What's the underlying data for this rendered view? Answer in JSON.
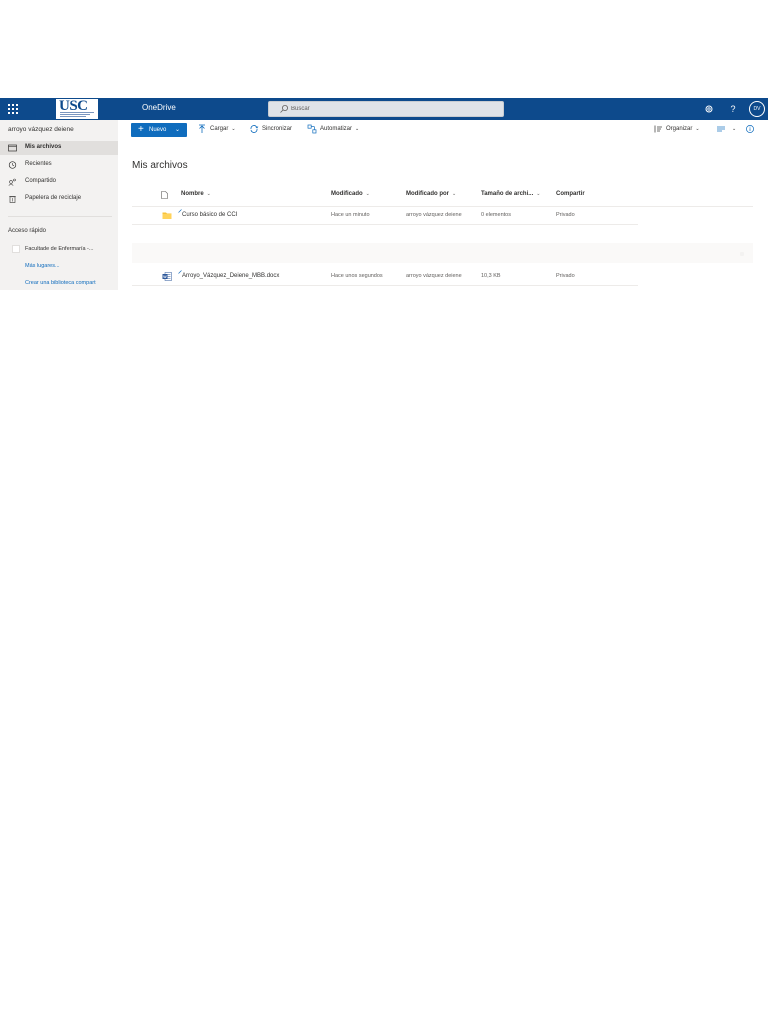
{
  "suite": {
    "app_name": "OneDrive",
    "logo_text": "USC",
    "search_placeholder": "Buscar",
    "avatar_initials": "DV"
  },
  "nav": {
    "username": "arroyo vázquez deiene",
    "items": [
      {
        "label": "Mis archivos",
        "icon": "folder-icon",
        "active": true
      },
      {
        "label": "Recientes",
        "icon": "clock-icon",
        "active": false
      },
      {
        "label": "Compartido",
        "icon": "people-icon",
        "active": false
      },
      {
        "label": "Papelera de reciclaje",
        "icon": "recycle-bin-icon",
        "active": false
      }
    ],
    "quick_access_title": "Acceso rápido",
    "quick_access_item": "Facultade de Enfermaría -...",
    "more_places": "Más lugares...",
    "create_library": "Crear una biblioteca compart"
  },
  "commandbar": {
    "new_label": "Nuevo",
    "upload_label": "Cargar",
    "sync_label": "Sincronizar",
    "automate_label": "Automatizar",
    "organize_label": "Organizar"
  },
  "content": {
    "title": "Mis archivos",
    "columns": {
      "name": "Nombre",
      "modified": "Modificado",
      "modified_by": "Modificado por",
      "size": "Tamaño de archi...",
      "sharing": "Compartir"
    },
    "rows": [
      {
        "name": "Curso básico de CCI",
        "type": "folder",
        "modified": "Hace un minuto",
        "modified_by": "arroyo vázquez deiene",
        "size": "0 elementos",
        "sharing": "Privado"
      },
      {
        "name": "Arroyo_Vázquez_Deiene_MBB.docx",
        "type": "word",
        "modified": "Hace unos segundos",
        "modified_by": "arroyo vázquez deiene",
        "size": "10,3 KB",
        "sharing": "Privado"
      }
    ]
  },
  "colors": {
    "suitebar": "#0d4a8c",
    "accent": "#0f6cbd",
    "folder": "#f8c33a",
    "word": "#2b579a"
  }
}
